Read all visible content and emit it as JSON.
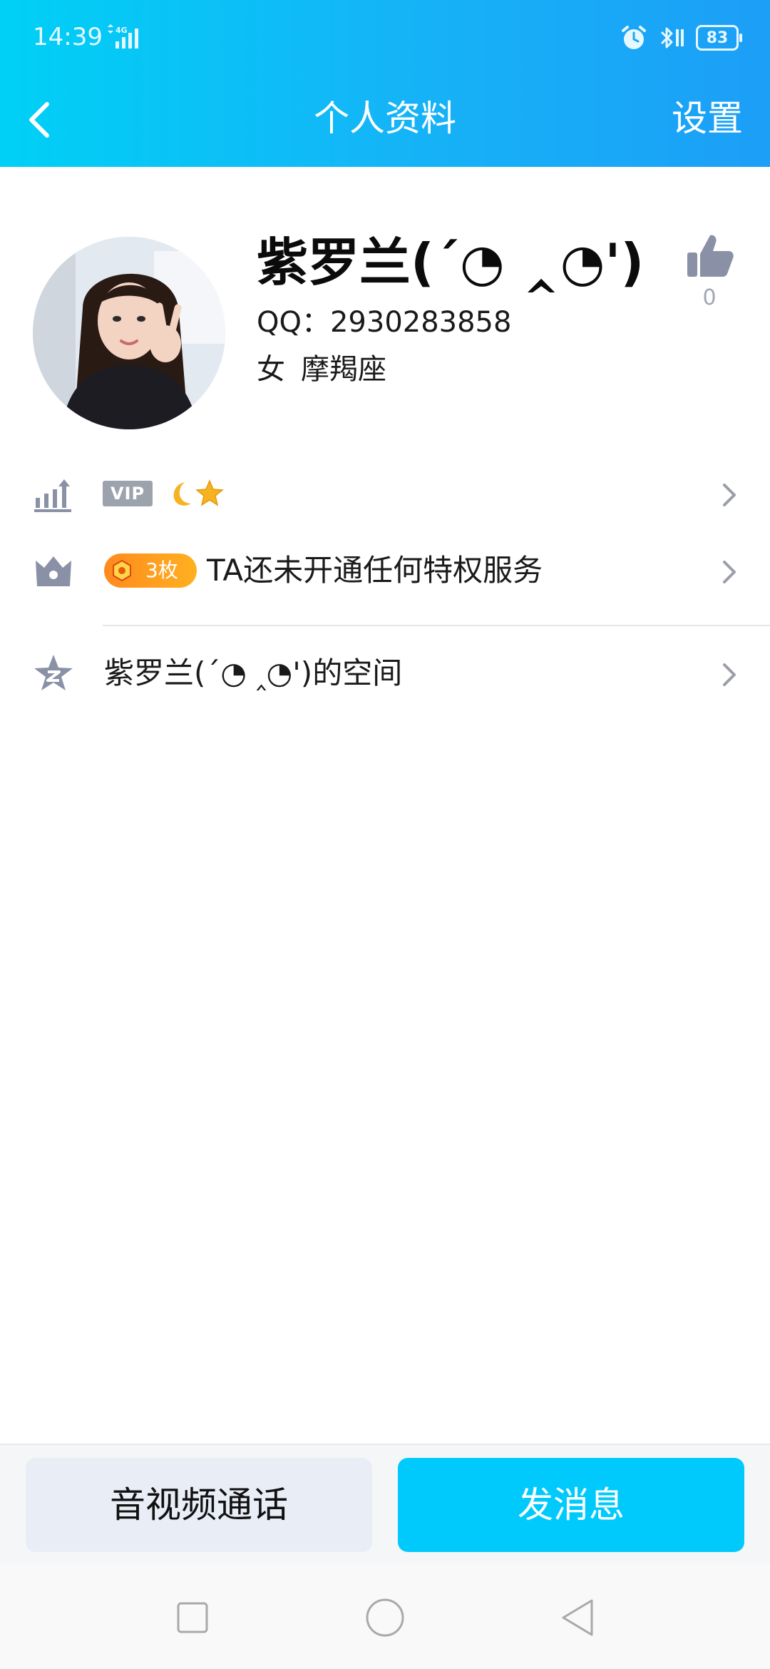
{
  "status_bar": {
    "time": "14:39",
    "network": "4G",
    "battery": "83"
  },
  "nav": {
    "title": "个人资料",
    "settings_label": "设置"
  },
  "profile": {
    "nickname": "紫罗兰(´◔ ‸◔')",
    "qq_line": "QQ：2930283858",
    "gender": "女",
    "constellation": "摩羯座",
    "like_count": "0"
  },
  "rows": {
    "level": {
      "vip_tag": "VIP",
      "level_icons": [
        "moon-icon",
        "star-icon"
      ]
    },
    "privilege": {
      "medal_count": "3枚",
      "text": "TA还未开通任何特权服务"
    },
    "space": {
      "text": "紫罗兰(´◔ ‸◔')的空间"
    }
  },
  "actions": {
    "call_label": "音视频通话",
    "message_label": "发消息"
  },
  "colors": {
    "header_start": "#00d0f6",
    "header_end": "#1c9ff7",
    "primary_button": "#00cafc",
    "secondary_button": "#e9edf5",
    "medal_start": "#ff8a1e",
    "medal_end": "#ffb020",
    "icon_gray": "#8a90a6"
  }
}
